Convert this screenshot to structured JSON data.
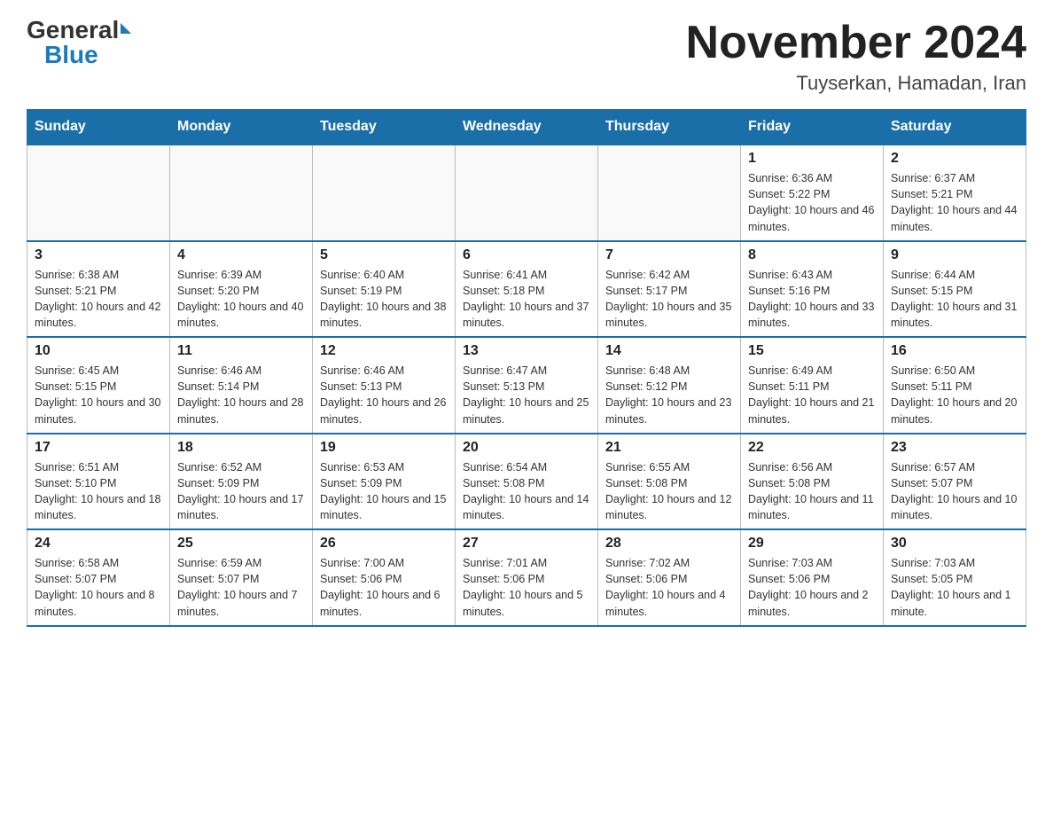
{
  "header": {
    "logo_general": "General",
    "logo_blue": "Blue",
    "month_title": "November 2024",
    "location": "Tuyserkan, Hamadan, Iran"
  },
  "days_of_week": [
    "Sunday",
    "Monday",
    "Tuesday",
    "Wednesday",
    "Thursday",
    "Friday",
    "Saturday"
  ],
  "weeks": [
    [
      {
        "day": "",
        "info": ""
      },
      {
        "day": "",
        "info": ""
      },
      {
        "day": "",
        "info": ""
      },
      {
        "day": "",
        "info": ""
      },
      {
        "day": "",
        "info": ""
      },
      {
        "day": "1",
        "info": "Sunrise: 6:36 AM\nSunset: 5:22 PM\nDaylight: 10 hours and 46 minutes."
      },
      {
        "day": "2",
        "info": "Sunrise: 6:37 AM\nSunset: 5:21 PM\nDaylight: 10 hours and 44 minutes."
      }
    ],
    [
      {
        "day": "3",
        "info": "Sunrise: 6:38 AM\nSunset: 5:21 PM\nDaylight: 10 hours and 42 minutes."
      },
      {
        "day": "4",
        "info": "Sunrise: 6:39 AM\nSunset: 5:20 PM\nDaylight: 10 hours and 40 minutes."
      },
      {
        "day": "5",
        "info": "Sunrise: 6:40 AM\nSunset: 5:19 PM\nDaylight: 10 hours and 38 minutes."
      },
      {
        "day": "6",
        "info": "Sunrise: 6:41 AM\nSunset: 5:18 PM\nDaylight: 10 hours and 37 minutes."
      },
      {
        "day": "7",
        "info": "Sunrise: 6:42 AM\nSunset: 5:17 PM\nDaylight: 10 hours and 35 minutes."
      },
      {
        "day": "8",
        "info": "Sunrise: 6:43 AM\nSunset: 5:16 PM\nDaylight: 10 hours and 33 minutes."
      },
      {
        "day": "9",
        "info": "Sunrise: 6:44 AM\nSunset: 5:15 PM\nDaylight: 10 hours and 31 minutes."
      }
    ],
    [
      {
        "day": "10",
        "info": "Sunrise: 6:45 AM\nSunset: 5:15 PM\nDaylight: 10 hours and 30 minutes."
      },
      {
        "day": "11",
        "info": "Sunrise: 6:46 AM\nSunset: 5:14 PM\nDaylight: 10 hours and 28 minutes."
      },
      {
        "day": "12",
        "info": "Sunrise: 6:46 AM\nSunset: 5:13 PM\nDaylight: 10 hours and 26 minutes."
      },
      {
        "day": "13",
        "info": "Sunrise: 6:47 AM\nSunset: 5:13 PM\nDaylight: 10 hours and 25 minutes."
      },
      {
        "day": "14",
        "info": "Sunrise: 6:48 AM\nSunset: 5:12 PM\nDaylight: 10 hours and 23 minutes."
      },
      {
        "day": "15",
        "info": "Sunrise: 6:49 AM\nSunset: 5:11 PM\nDaylight: 10 hours and 21 minutes."
      },
      {
        "day": "16",
        "info": "Sunrise: 6:50 AM\nSunset: 5:11 PM\nDaylight: 10 hours and 20 minutes."
      }
    ],
    [
      {
        "day": "17",
        "info": "Sunrise: 6:51 AM\nSunset: 5:10 PM\nDaylight: 10 hours and 18 minutes."
      },
      {
        "day": "18",
        "info": "Sunrise: 6:52 AM\nSunset: 5:09 PM\nDaylight: 10 hours and 17 minutes."
      },
      {
        "day": "19",
        "info": "Sunrise: 6:53 AM\nSunset: 5:09 PM\nDaylight: 10 hours and 15 minutes."
      },
      {
        "day": "20",
        "info": "Sunrise: 6:54 AM\nSunset: 5:08 PM\nDaylight: 10 hours and 14 minutes."
      },
      {
        "day": "21",
        "info": "Sunrise: 6:55 AM\nSunset: 5:08 PM\nDaylight: 10 hours and 12 minutes."
      },
      {
        "day": "22",
        "info": "Sunrise: 6:56 AM\nSunset: 5:08 PM\nDaylight: 10 hours and 11 minutes."
      },
      {
        "day": "23",
        "info": "Sunrise: 6:57 AM\nSunset: 5:07 PM\nDaylight: 10 hours and 10 minutes."
      }
    ],
    [
      {
        "day": "24",
        "info": "Sunrise: 6:58 AM\nSunset: 5:07 PM\nDaylight: 10 hours and 8 minutes."
      },
      {
        "day": "25",
        "info": "Sunrise: 6:59 AM\nSunset: 5:07 PM\nDaylight: 10 hours and 7 minutes."
      },
      {
        "day": "26",
        "info": "Sunrise: 7:00 AM\nSunset: 5:06 PM\nDaylight: 10 hours and 6 minutes."
      },
      {
        "day": "27",
        "info": "Sunrise: 7:01 AM\nSunset: 5:06 PM\nDaylight: 10 hours and 5 minutes."
      },
      {
        "day": "28",
        "info": "Sunrise: 7:02 AM\nSunset: 5:06 PM\nDaylight: 10 hours and 4 minutes."
      },
      {
        "day": "29",
        "info": "Sunrise: 7:03 AM\nSunset: 5:06 PM\nDaylight: 10 hours and 2 minutes."
      },
      {
        "day": "30",
        "info": "Sunrise: 7:03 AM\nSunset: 5:05 PM\nDaylight: 10 hours and 1 minute."
      }
    ]
  ]
}
